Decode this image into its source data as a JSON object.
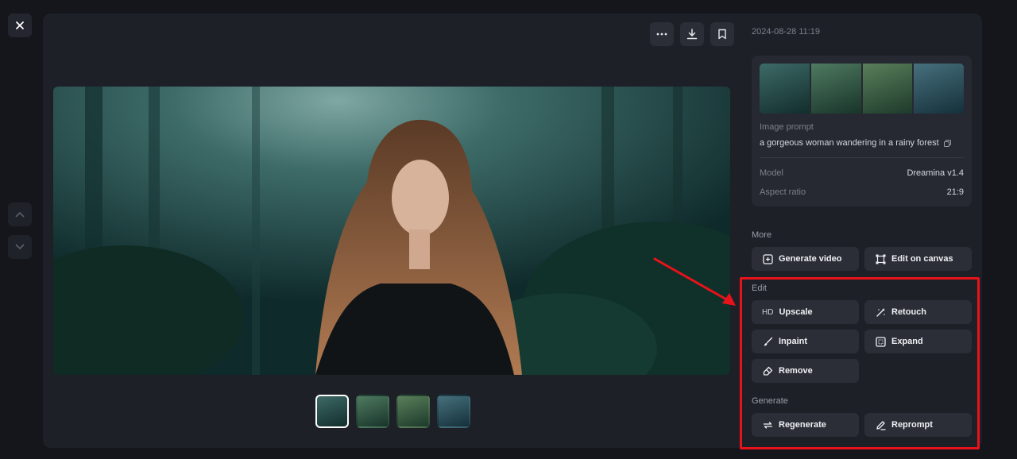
{
  "timestamp": "2024-08-28 11:19",
  "info": {
    "prompt_label": "Image prompt",
    "prompt_text": "a gorgeous woman wandering in a rainy forest",
    "model_label": "Model",
    "model_value": "Dreamina v1.4",
    "aspect_label": "Aspect ratio",
    "aspect_value": "21:9"
  },
  "more": {
    "label": "More",
    "generate_video": "Generate video",
    "edit_on_canvas": "Edit on canvas"
  },
  "edit": {
    "label": "Edit",
    "upscale_badge": "HD",
    "upscale": "Upscale",
    "retouch": "Retouch",
    "inpaint": "Inpaint",
    "expand": "Expand",
    "remove": "Remove"
  },
  "generate": {
    "label": "Generate",
    "regenerate": "Regenerate",
    "reprompt": "Reprompt"
  },
  "icons": {
    "close": "close-icon",
    "prev": "chevron-up-icon",
    "next": "chevron-down-icon",
    "more": "ellipsis-icon",
    "download": "download-icon",
    "bookmark": "bookmark-icon",
    "copy": "copy-icon"
  },
  "colors": {
    "highlight": "#e8121a",
    "panel": "#1e2027",
    "button": "#2b2e36"
  }
}
